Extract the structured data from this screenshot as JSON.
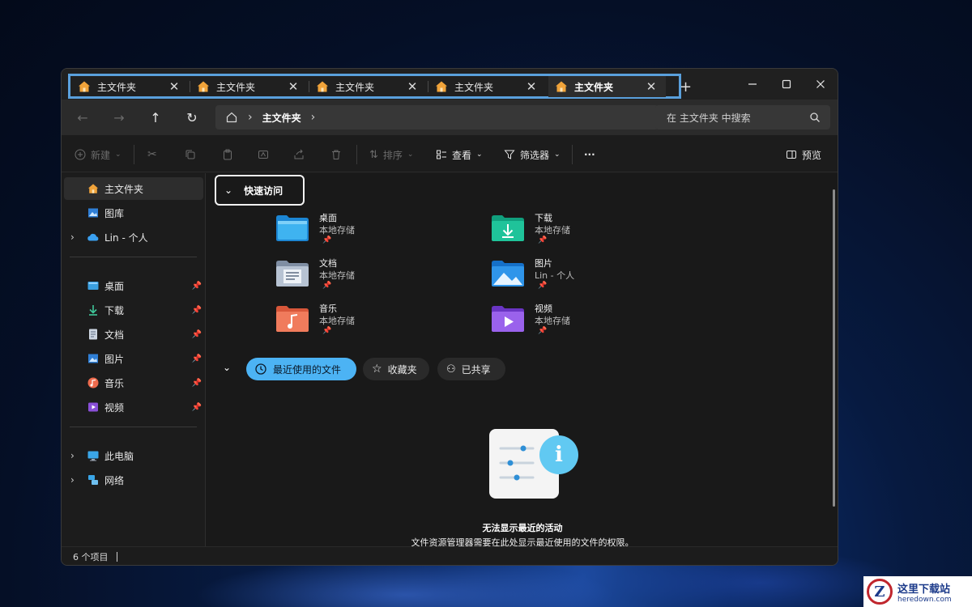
{
  "tabs": [
    {
      "label": "主文件夹"
    },
    {
      "label": "主文件夹"
    },
    {
      "label": "主文件夹"
    },
    {
      "label": "主文件夹"
    },
    {
      "label": "主文件夹"
    }
  ],
  "active_tab": 4,
  "window_controls": {
    "new_tab": "+"
  },
  "nav": {
    "breadcrumb": "主文件夹",
    "search_placeholder": "在 主文件夹 中搜索"
  },
  "commands": {
    "new": "新建",
    "sort": "排序",
    "view": "查看",
    "filter": "筛选器",
    "more": "···",
    "preview": "预览"
  },
  "sidebar": {
    "top": [
      {
        "label": "主文件夹",
        "icon": "home-icon"
      },
      {
        "label": "图库",
        "icon": "gallery-icon"
      },
      {
        "label": "Lin - 个人",
        "icon": "onedrive-icon"
      }
    ],
    "pinned": [
      {
        "label": "桌面",
        "icon": "desktop-icon"
      },
      {
        "label": "下载",
        "icon": "download-icon"
      },
      {
        "label": "文档",
        "icon": "document-icon"
      },
      {
        "label": "图片",
        "icon": "pictures-icon"
      },
      {
        "label": "音乐",
        "icon": "music-icon"
      },
      {
        "label": "视频",
        "icon": "video-icon"
      }
    ],
    "bottom": [
      {
        "label": "此电脑",
        "icon": "pc-icon"
      },
      {
        "label": "网络",
        "icon": "network-icon"
      }
    ]
  },
  "quick_access": {
    "title": "快速访问",
    "items": [
      {
        "name": "桌面",
        "location": "本地存储"
      },
      {
        "name": "下载",
        "location": "本地存储"
      },
      {
        "name": "文档",
        "location": "本地存储"
      },
      {
        "name": "图片",
        "location": "Lin - 个人"
      },
      {
        "name": "音乐",
        "location": "本地存储"
      },
      {
        "name": "视频",
        "location": "本地存储"
      }
    ]
  },
  "recent_tabs": {
    "recent": "最近使用的文件",
    "favorites": "收藏夹",
    "shared": "已共享"
  },
  "empty_state": {
    "title": "无法显示最近的活动",
    "description": "文件资源管理器需要在此处显示最近使用的文件的权限。"
  },
  "status": {
    "count": "6 个项目"
  },
  "watermark": {
    "title": "这里下载站",
    "url": "heredown.com",
    "logo_letter": "Z"
  },
  "colors": {
    "accent": "#4cb3f4",
    "tab_highlight": "#5aa0dc"
  }
}
